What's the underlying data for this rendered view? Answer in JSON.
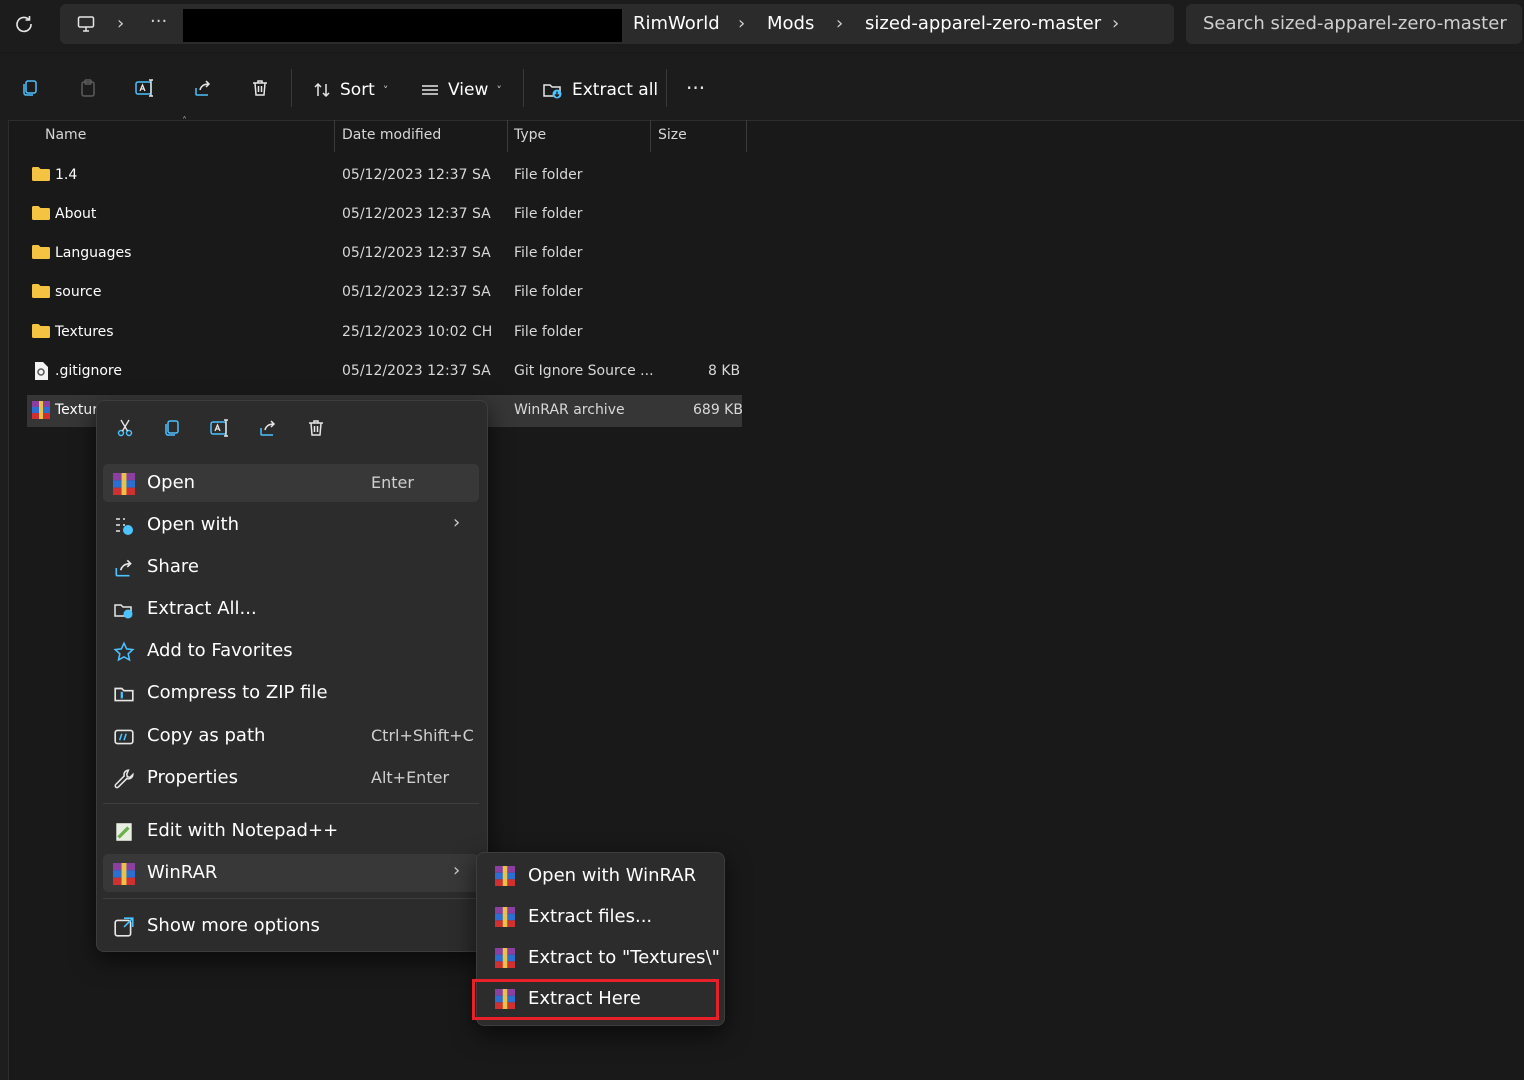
{
  "address_bar": {
    "breadcrumbs": [
      "RimWorld",
      "Mods",
      "sized-apparel-zero-master"
    ],
    "search_placeholder": "Search sized-apparel-zero-master"
  },
  "toolbar": {
    "sort_label": "Sort",
    "view_label": "View",
    "extract_all_label": "Extract all"
  },
  "columns": [
    "Name",
    "Date modified",
    "Type",
    "Size"
  ],
  "files": [
    {
      "name": "1.4",
      "date": "05/12/2023 12:37 SA",
      "type": "File folder",
      "size": "",
      "icon": "folder-icon"
    },
    {
      "name": "About",
      "date": "05/12/2023 12:37 SA",
      "type": "File folder",
      "size": "",
      "icon": "folder-icon"
    },
    {
      "name": "Languages",
      "date": "05/12/2023 12:37 SA",
      "type": "File folder",
      "size": "",
      "icon": "folder-icon"
    },
    {
      "name": "source",
      "date": "05/12/2023 12:37 SA",
      "type": "File folder",
      "size": "",
      "icon": "folder-icon"
    },
    {
      "name": "Textures",
      "date": "25/12/2023 10:02 CH",
      "type": "File folder",
      "size": "",
      "icon": "folder-icon"
    },
    {
      "name": ".gitignore",
      "date": "05/12/2023 12:37 SA",
      "type": "Git Ignore Source ...",
      "size": "8 KB",
      "icon": "file-icon"
    },
    {
      "name": "Texture",
      "date": "",
      "type": "WinRAR archive",
      "size": "689 KB",
      "icon": "winrar-icon",
      "selected": true
    }
  ],
  "context_menu": {
    "items": [
      {
        "label": "Open",
        "accel": "Enter",
        "icon": "winrar-icon"
      },
      {
        "label": "Open with",
        "accel": "",
        "icon": "open-with-icon",
        "submenu": true
      },
      {
        "label": "Share",
        "accel": "",
        "icon": "share-icon"
      },
      {
        "label": "Extract All...",
        "accel": "",
        "icon": "extract-icon"
      },
      {
        "label": "Add to Favorites",
        "accel": "",
        "icon": "star-icon"
      },
      {
        "label": "Compress to ZIP file",
        "accel": "",
        "icon": "zip-icon"
      },
      {
        "label": "Copy as path",
        "accel": "Ctrl+Shift+C",
        "icon": "path-icon"
      },
      {
        "label": "Properties",
        "accel": "Alt+Enter",
        "icon": "wrench-icon"
      },
      {
        "label": "Edit with Notepad++",
        "accel": "",
        "icon": "notepad-icon"
      },
      {
        "label": "WinRAR",
        "accel": "",
        "icon": "winrar-icon",
        "submenu": true
      },
      {
        "label": "Show more options",
        "accel": "",
        "icon": "more-options-icon"
      }
    ]
  },
  "winrar_submenu": {
    "items": [
      {
        "label": "Open with WinRAR"
      },
      {
        "label": "Extract files..."
      },
      {
        "label": "Extract to \"Textures\\\""
      },
      {
        "label": "Extract Here"
      }
    ]
  },
  "colors": {
    "highlight_border": "#e8202a",
    "folder": "#f5c342",
    "accent": "#4cc2ff"
  }
}
